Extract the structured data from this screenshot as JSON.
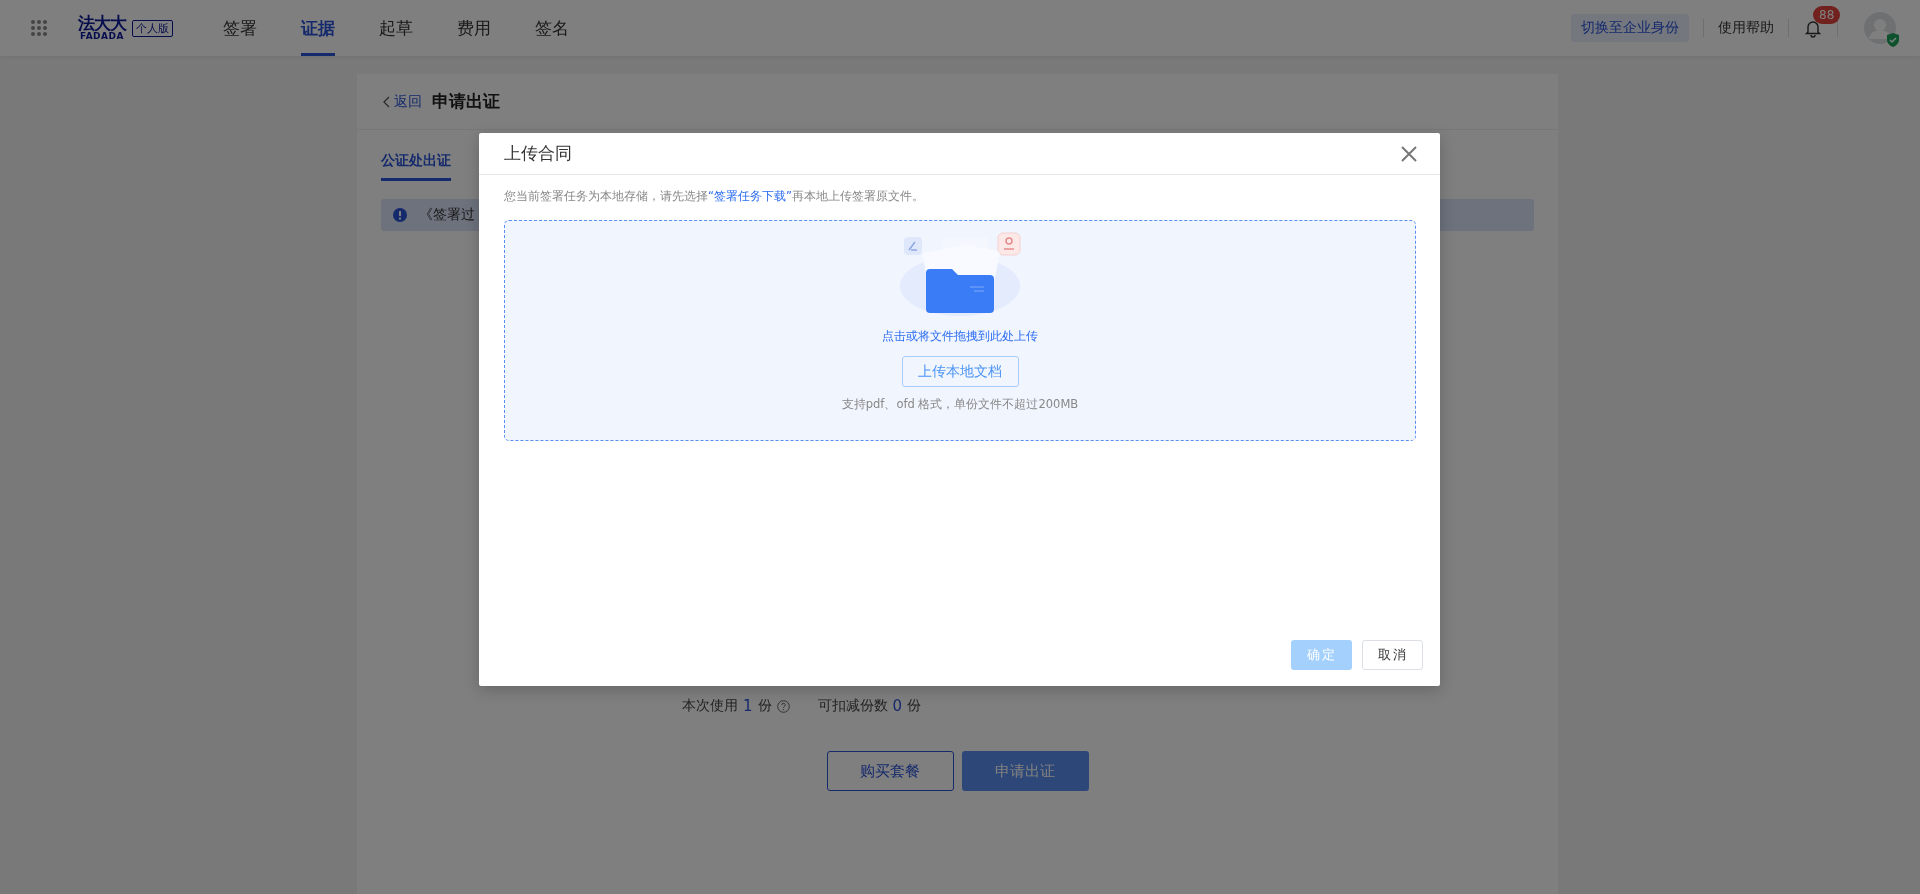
{
  "topbar": {
    "logo": {
      "name": "法大大",
      "sub": "FADADA"
    },
    "edition": "个人版",
    "nav": [
      {
        "label": "签署",
        "selected": false
      },
      {
        "label": "证据",
        "selected": true
      },
      {
        "label": "起草",
        "selected": false
      },
      {
        "label": "费用",
        "selected": false
      },
      {
        "label": "签名",
        "selected": false
      }
    ],
    "switch_button": "切换至企业身份",
    "help": "使用帮助",
    "notification_count": "88"
  },
  "page": {
    "back": "返回",
    "title": "申请出证",
    "tabs": [
      {
        "label": "公证处出证",
        "selected": true
      }
    ],
    "alert": "《签署过",
    "usage": {
      "used_label": "本次使用",
      "used_count": "1",
      "used_unit": "份",
      "deductible_label": "可扣减份数",
      "deductible_count": "0",
      "deductible_unit": "份"
    },
    "buttons": [
      {
        "label": "购买套餐",
        "kind": "outline"
      },
      {
        "label": "申请出证",
        "kind": "primary"
      }
    ]
  },
  "dialog": {
    "title": "上传合同",
    "notice": {
      "before": "您当前签署任务为本地存储，请先选择",
      "link": "“签署任务下载”",
      "after": "再本地上传签署原文件。"
    },
    "dropzone": {
      "hint": "点击或将文件拖拽到此处上传",
      "button": "上传本地文档",
      "formats": "支持pdf、ofd 格式，单份文件不超过200MB"
    },
    "footer": [
      {
        "label": "确定",
        "kind": "primary",
        "disabled": true
      },
      {
        "label": "取消",
        "kind": "default",
        "disabled": false
      }
    ]
  }
}
